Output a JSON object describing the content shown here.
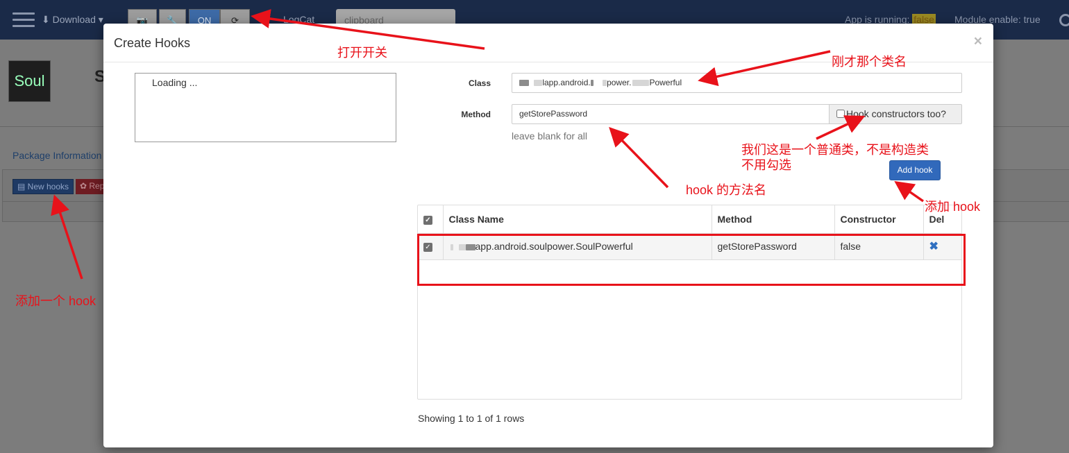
{
  "navbar": {
    "download_label": "⬇ Download ▾",
    "on_label": "ON",
    "refresh_icon": "⟳",
    "logcat_label": "LogCat",
    "search_value": "clipboard",
    "app_running_label": "App is running:",
    "app_running_value": "false",
    "module_status": "Module enable: true"
  },
  "background": {
    "logo_text": "Soul",
    "title_letter": "S",
    "package_tab": "Package Information",
    "new_hooks_label": "New hooks",
    "rep_label": "Rep"
  },
  "modal": {
    "title": "Create Hooks",
    "close": "×",
    "tree_loading": "Loading ...",
    "class_label": "Class",
    "class_value_parts": [
      "lapp.android.",
      "power.",
      "Powerful"
    ],
    "method_label": "Method",
    "method_value": "getStorePassword",
    "constructor_checkbox_label": "Hook constructors too?",
    "help_text": "leave blank for all",
    "add_hook_label": "Add hook",
    "table": {
      "headers": [
        "Class Name",
        "Method",
        "Constructor",
        "Del"
      ],
      "rows": [
        {
          "class_name": "app.android.soulpower.SoulPowerful",
          "method": "getStorePassword",
          "constructor": "false",
          "del": "✖"
        }
      ]
    },
    "footer": "Showing 1 to 1 of 1 rows"
  },
  "annotations": {
    "open_switch": "打开开关",
    "class_name_note": "刚才那个类名",
    "normal_class_line1": "我们这是一个普通类，不是构造类",
    "normal_class_line2": "不用勾选",
    "method_name_note": "hook 的方法名",
    "add_hook_note": "添加 hook",
    "add_one_hook_note": "添加一个 hook"
  },
  "colors": {
    "annotation_red": "#e8121a",
    "primary_blue": "#3169bb",
    "navbar": "#1a2a48"
  }
}
